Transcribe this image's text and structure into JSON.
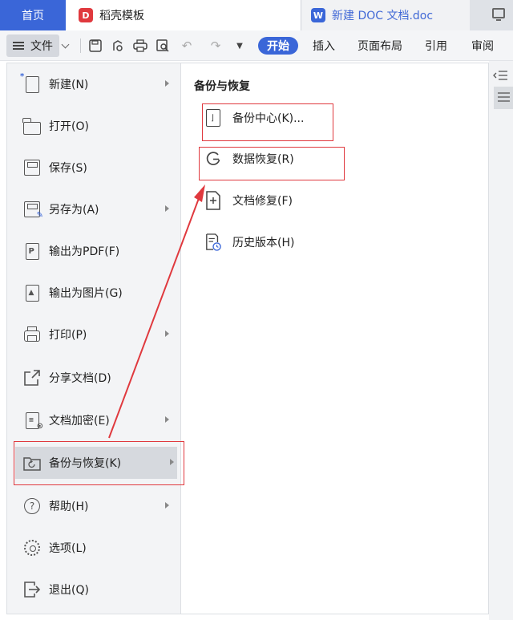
{
  "tabs": {
    "home": "首页",
    "templates": "稻壳模板",
    "document": "新建 DOC 文档.doc"
  },
  "toolbar": {
    "file_label": "文件",
    "ribbon": [
      "开始",
      "插入",
      "页面布局",
      "引用",
      "审阅"
    ]
  },
  "menu": {
    "items": [
      {
        "label": "新建(N)",
        "icon": "new-document-icon",
        "has_submenu": true
      },
      {
        "label": "打开(O)",
        "icon": "folder-open-icon",
        "has_submenu": false
      },
      {
        "label": "保存(S)",
        "icon": "save-icon",
        "has_submenu": false
      },
      {
        "label": "另存为(A)",
        "icon": "save-as-icon",
        "has_submenu": true
      },
      {
        "label": "输出为PDF(F)",
        "icon": "pdf-export-icon",
        "has_submenu": false
      },
      {
        "label": "输出为图片(G)",
        "icon": "image-export-icon",
        "has_submenu": false
      },
      {
        "label": "打印(P)",
        "icon": "printer-icon",
        "has_submenu": true
      },
      {
        "label": "分享文档(D)",
        "icon": "share-icon",
        "has_submenu": false
      },
      {
        "label": "文档加密(E)",
        "icon": "encrypt-icon",
        "has_submenu": true
      },
      {
        "label": "备份与恢复(K)",
        "icon": "backup-icon",
        "has_submenu": true
      },
      {
        "label": "帮助(H)",
        "icon": "help-icon",
        "has_submenu": true
      },
      {
        "label": "选项(L)",
        "icon": "gear-icon",
        "has_submenu": false
      },
      {
        "label": "退出(Q)",
        "icon": "exit-icon",
        "has_submenu": false
      }
    ],
    "active": "备份与恢复(K)"
  },
  "submenu": {
    "title": "备份与恢复",
    "items": [
      {
        "label": "备份中心(K)...",
        "icon": "backup-center-icon"
      },
      {
        "label": "数据恢复(R)",
        "icon": "data-restore-icon"
      },
      {
        "label": "文档修复(F)",
        "icon": "document-repair-icon"
      },
      {
        "label": "历史版本(H)",
        "icon": "history-version-icon"
      }
    ]
  },
  "colors": {
    "accent": "#3a66d8",
    "annotation": "#e0393e"
  }
}
